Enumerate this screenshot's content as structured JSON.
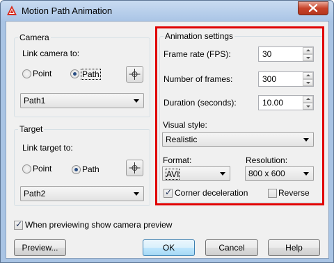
{
  "window": {
    "title": "Motion Path Animation",
    "app_icon": "autocad-icon",
    "close_icon": "close-icon"
  },
  "camera": {
    "group_title": "Camera",
    "link_label": "Link camera to:",
    "point_label": "Point",
    "path_label": "Path",
    "selected": "Path",
    "pick_icon": "pick-point-icon",
    "path_value": "Path1"
  },
  "target": {
    "group_title": "Target",
    "link_label": "Link target to:",
    "point_label": "Point",
    "path_label": "Path",
    "selected": "Path",
    "pick_icon": "pick-point-icon",
    "path_value": "Path2"
  },
  "animation": {
    "group_title": "Animation settings",
    "frame_rate_label": "Frame rate (FPS):",
    "frame_rate_value": "30",
    "frames_label": "Number of frames:",
    "frames_value": "300",
    "duration_label": "Duration (seconds):",
    "duration_value": "10.00",
    "visual_style_label": "Visual style:",
    "visual_style_value": "Realistic",
    "format_label": "Format:",
    "format_value": "AVI",
    "resolution_label": "Resolution:",
    "resolution_value": "800 x 600",
    "corner_label": "Corner deceleration",
    "corner_checked": true,
    "reverse_label": "Reverse",
    "reverse_checked": false
  },
  "preview_option": {
    "label": "When previewing show camera preview",
    "checked": true
  },
  "buttons": {
    "preview": "Preview...",
    "ok": "OK",
    "cancel": "Cancel",
    "help": "Help"
  },
  "colors": {
    "highlight": "#e00000",
    "title_bar": "#aac5e6",
    "close_button": "#c7432a"
  }
}
